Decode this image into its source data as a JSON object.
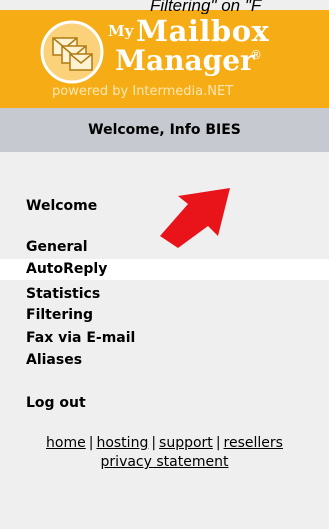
{
  "caption": "Filtering\" on \"F",
  "logo": {
    "my": "My",
    "mailbox": "Mailbox",
    "manager": "Manager",
    "registered": "®",
    "powered_by": "powered by Intermedia.NET"
  },
  "welcome": "Welcome, Info BIES",
  "nav": {
    "welcome": "Welcome",
    "general": "General",
    "autoreply": "AutoReply",
    "statistics": "Statistics",
    "filtering": "Filtering",
    "fax": "Fax via E-mail",
    "aliases": "Aliases",
    "logout": "Log out"
  },
  "footer": {
    "home": "home",
    "hosting": "hosting",
    "support": "support",
    "resellers": "resellers",
    "privacy": "privacy statement",
    "separator": "|"
  },
  "colors": {
    "logo_background": "#f6ac14",
    "welcome_bar": "#c6c9cf",
    "sidebar": "#efefef",
    "arrow": "#e8141a"
  },
  "icons": [
    "mailbox-envelopes-icon",
    "red-arrow-icon"
  ]
}
